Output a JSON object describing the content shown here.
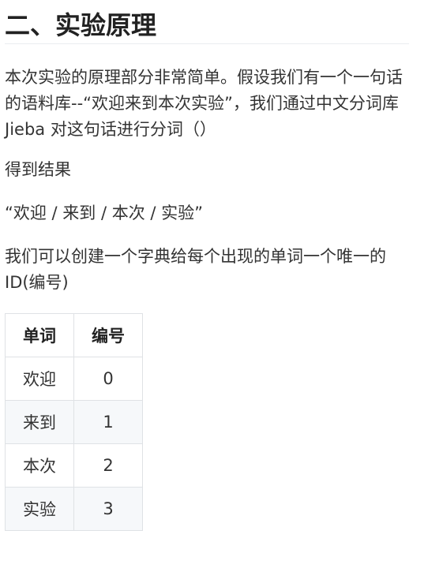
{
  "heading": "二、实验原理",
  "paragraphs": {
    "intro": "本次实验的原理部分非常简单。假设我们有一个一句话的语料库--“欢迎来到本次实验”，我们通过中文分词库 Jieba 对这句话进行分词（）",
    "result_label": "得到结果",
    "result": "“欢迎 / 来到 / 本次 / 实验”",
    "dict_desc": "我们可以创建一个字典给每个出现的单词一个唯一的 ID(编号)"
  },
  "table": {
    "headers": [
      "单词",
      "编号"
    ],
    "rows": [
      [
        "欢迎",
        "0"
      ],
      [
        "来到",
        "1"
      ],
      [
        "本次",
        "2"
      ],
      [
        "实验",
        "3"
      ]
    ]
  }
}
